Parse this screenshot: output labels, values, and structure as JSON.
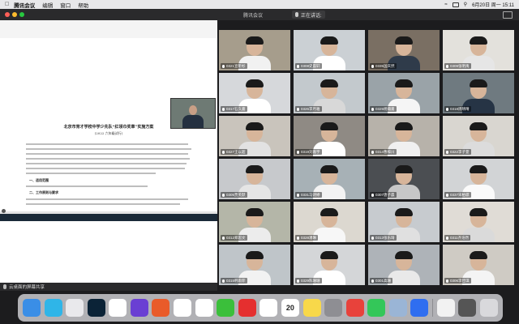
{
  "menubar": {
    "app_name": "腾讯会议",
    "items": [
      "编辑",
      "窗口",
      "帮助"
    ],
    "datetime": "6月20日 周一 15:11"
  },
  "window": {
    "title": "腾讯会议",
    "speaking_label": "正在讲话:"
  },
  "document": {
    "title": "北京市育才学校中学少先队“红领巾奖章”实施方案",
    "subtitle": "(2022 六年级试行)",
    "heading1": "一、适用范围",
    "heading2": "二、工作原则与要求"
  },
  "share": {
    "footer_text": "云桌面的屏幕共享"
  },
  "participants": [
    {
      "name": "0321宣昕杉"
    },
    {
      "name": "0308史晨轩"
    },
    {
      "name": "0335国庆然"
    },
    {
      "name": "0309张明禹"
    },
    {
      "name": "0317石久嘉"
    },
    {
      "name": "0326李月雅"
    },
    {
      "name": "0325杨瀚嘉"
    },
    {
      "name": "0318周晴晴"
    },
    {
      "name": "0327王以超"
    },
    {
      "name": "0319刘嘉宇"
    },
    {
      "name": "0314曹梓川"
    },
    {
      "name": "0322李子萱"
    },
    {
      "name": "0305贾英默"
    },
    {
      "name": "0331马诗婷"
    },
    {
      "name": "0307唐子晨"
    },
    {
      "name": "0337宋柏骐"
    },
    {
      "name": "0312郑思文"
    },
    {
      "name": "0328潘琳"
    },
    {
      "name": "0313张乐琦"
    },
    {
      "name": "0311齐浩然"
    },
    {
      "name": "0315韩雨菲"
    },
    {
      "name": "0329陈珊珊"
    },
    {
      "name": "0301高珊"
    },
    {
      "name": "0306李佳琪"
    }
  ],
  "colors": {
    "accent": "#2f6ef0"
  },
  "dock": {
    "icons": [
      "finder-icon",
      "launchpad-icon",
      "apps-icon",
      "photoshop-icon",
      "chrome-icon",
      "vpn-icon",
      "imovie-icon",
      "keynote-icon",
      "airdrop-icon",
      "wechat-icon",
      "netease-music-icon",
      "photos-icon",
      "calendar-icon",
      "notes-icon",
      "system-preferences-icon",
      "wps-icon",
      "facetime-icon",
      "preview-icon",
      "tencent-meeting-icon",
      "documents-icon",
      "stack-icon",
      "trash-icon"
    ],
    "calendar_day": "20"
  }
}
